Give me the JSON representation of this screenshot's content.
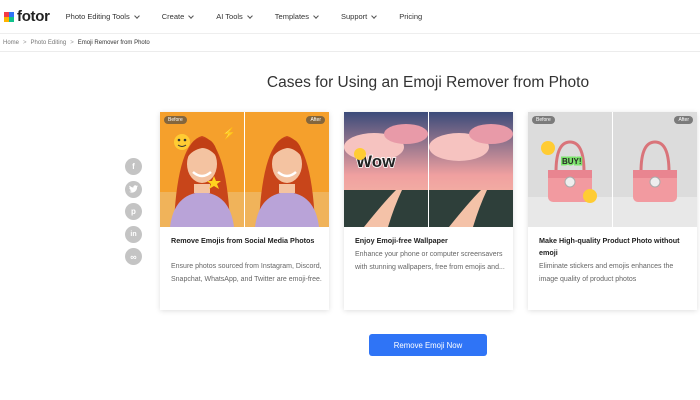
{
  "nav": {
    "logo_text": "fotor",
    "logo_colors": [
      "#f43b47",
      "#2f74f6",
      "#ffb300",
      "#12c28c"
    ],
    "menu": [
      {
        "label": "Photo Editing Tools",
        "has_dropdown": true
      },
      {
        "label": "Create",
        "has_dropdown": true
      },
      {
        "label": "AI Tools",
        "has_dropdown": true
      },
      {
        "label": "Templates",
        "has_dropdown": true
      },
      {
        "label": "Support",
        "has_dropdown": true
      },
      {
        "label": "Pricing",
        "has_dropdown": false
      }
    ]
  },
  "breadcrumb": {
    "items": [
      "Home",
      "Photo Editing",
      "Emoji Remover from Photo"
    ],
    "separator": ">"
  },
  "page_title": "Cases for Using an Emoji Remover from Photo",
  "share": {
    "icons": [
      "facebook-icon",
      "twitter-icon",
      "pinterest-icon",
      "linkedin-icon",
      "link-icon"
    ],
    "glyphs": [
      "f",
      "t",
      "p",
      "in",
      "∞"
    ]
  },
  "cards": [
    {
      "before_label": "Before",
      "after_label": "After",
      "title": "Remove Emojis from Social Media Photos",
      "description": "Ensure photos sourced from Instagram, Discord, Snapchat, WhatsApp, and Twitter are emoji-free."
    },
    {
      "before_label": "",
      "after_label": "",
      "sticker_text": "Wow",
      "title": "Enjoy Emoji-free Wallpaper",
      "description": "Enhance your phone or computer screensavers with stunning wallpapers, free from emojis and..."
    },
    {
      "before_label": "Before",
      "after_label": "After",
      "sticker_text": "BUY!",
      "title": "Make High-quality Product Photo without emoji",
      "description": "Eliminate stickers and emojis enhances the image quality of product photos"
    }
  ],
  "cta": {
    "label": "Remove Emoji Now"
  },
  "colors": {
    "accent": "#2f74f6",
    "share_gray": "#c4c4c4"
  }
}
